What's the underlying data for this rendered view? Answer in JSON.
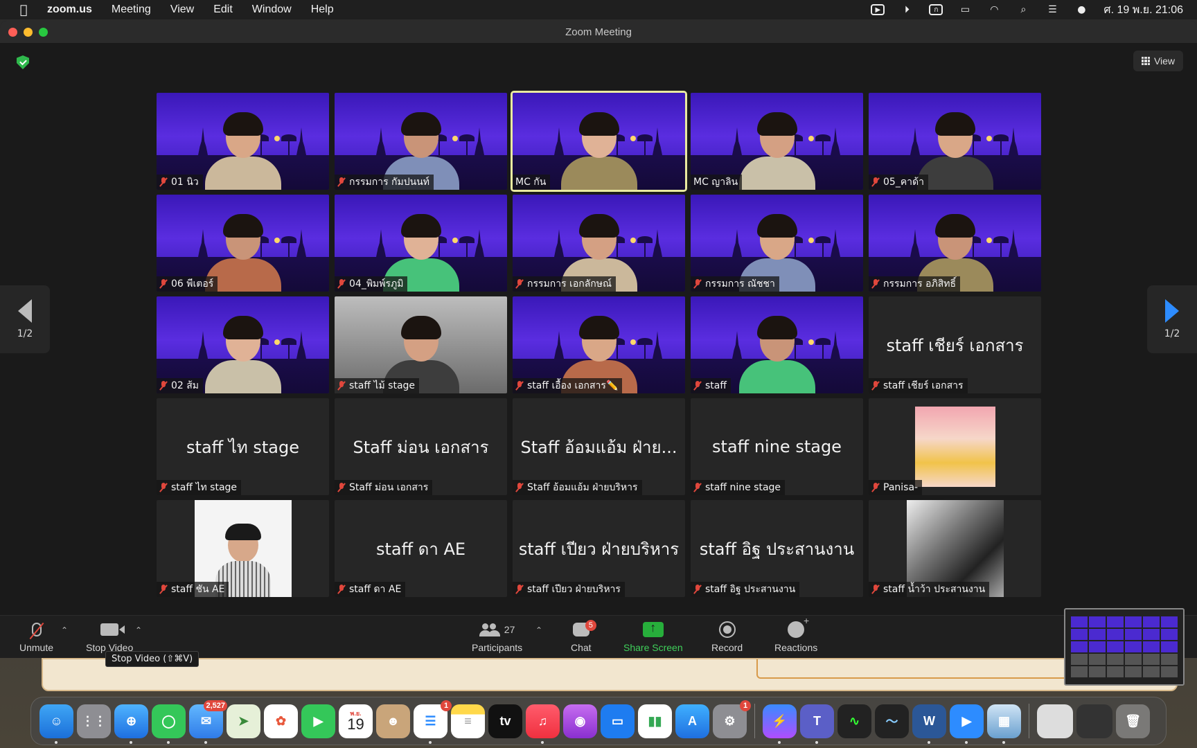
{
  "menubar": {
    "app_name": "zoom.us",
    "items": [
      "Meeting",
      "View",
      "Edit",
      "Window",
      "Help"
    ],
    "clock": "ศ. 19 พ.ย.  21:06"
  },
  "window": {
    "title": "Zoom Meeting",
    "view_label": "View",
    "page_left": "1/2",
    "page_right": "1/2"
  },
  "tiles": [
    {
      "label": "01 นิว",
      "muted": true,
      "video": true
    },
    {
      "label": "กรรมการ กัมปนนท์",
      "muted": true,
      "video": true
    },
    {
      "label": "MC กัน",
      "muted": false,
      "video": true,
      "active": true
    },
    {
      "label": "MC ญาลิน",
      "muted": false,
      "video": true
    },
    {
      "label": "05_คาด้า",
      "muted": true,
      "video": true
    },
    {
      "label": "06 พีเตอร์",
      "muted": true,
      "video": true
    },
    {
      "label": "04_พิมพ์รภูมิ",
      "muted": true,
      "video": true
    },
    {
      "label": "กรรมการ เอกลักษณ์",
      "muted": true,
      "video": true
    },
    {
      "label": "กรรมการ ณัชชา",
      "muted": true,
      "video": true
    },
    {
      "label": "กรรมการ อภิสิทธิ์",
      "muted": true,
      "video": true
    },
    {
      "label": "02 ส้ม",
      "muted": true,
      "video": true
    },
    {
      "label": "staff ไม้ stage",
      "muted": true,
      "video": true,
      "plain": true
    },
    {
      "label": "staff เอื้อง เอกสาร✏️",
      "muted": true,
      "video": true
    },
    {
      "label": "staff",
      "muted": true,
      "video": true
    },
    {
      "label": "staff เชียร์ เอกสาร",
      "muted": true,
      "video": false,
      "bigname": "staff เชียร์ เอกสาร"
    },
    {
      "label": "staff ไท stage",
      "muted": true,
      "video": false,
      "bigname": "staff ไท stage"
    },
    {
      "label": "Staff ม่อน เอกสาร",
      "muted": true,
      "video": false,
      "bigname": "Staff ม่อน เอกสาร"
    },
    {
      "label": "Staff อ้อมแอ้ม ฝ่ายบริหาร",
      "muted": true,
      "video": false,
      "bigname": "Staff อ้อมแอ้ม ฝ่าย..."
    },
    {
      "label": "staff nine stage",
      "muted": true,
      "video": false,
      "bigname": "staff nine stage"
    },
    {
      "label": "Panisa-",
      "muted": true,
      "video": false,
      "photo": "plush"
    },
    {
      "label": "staff ชัน AE",
      "muted": true,
      "video": false,
      "photo": "portrait"
    },
    {
      "label": "staff ดา AE",
      "muted": true,
      "video": false,
      "bigname": "staff ดา AE"
    },
    {
      "label": "staff เปียว ฝ่ายบริหาร",
      "muted": true,
      "video": false,
      "bigname": "staff เปียว ฝ่ายบริหาร"
    },
    {
      "label": "staff อิฐ ประสานงาน",
      "muted": true,
      "video": false,
      "bigname": "staff อิฐ ประสานงาน"
    },
    {
      "label": "staff น้ำว้า ประสานงาน",
      "muted": true,
      "video": false,
      "photo": "bw"
    }
  ],
  "toolbar": {
    "unmute": "Unmute",
    "stop_video": "Stop Video",
    "participants": "Participants",
    "participant_count": "27",
    "chat": "Chat",
    "chat_badge": "5",
    "share_screen": "Share Screen",
    "record": "Record",
    "reactions": "Reactions",
    "tooltip": "Stop Video (⇧⌘V)"
  },
  "dock": {
    "mail_badge": "2,527",
    "reminders_badge": "1",
    "settings_badge": "1",
    "calendar_day": "19",
    "calendar_month": "พ.ย.",
    "tv_label": "tv"
  },
  "colors": {
    "accent_green": "#27ae3b",
    "muted_red": "#e0473c",
    "active_speaker": "#e9eaa0",
    "arrow_blue": "#2d8cff"
  }
}
